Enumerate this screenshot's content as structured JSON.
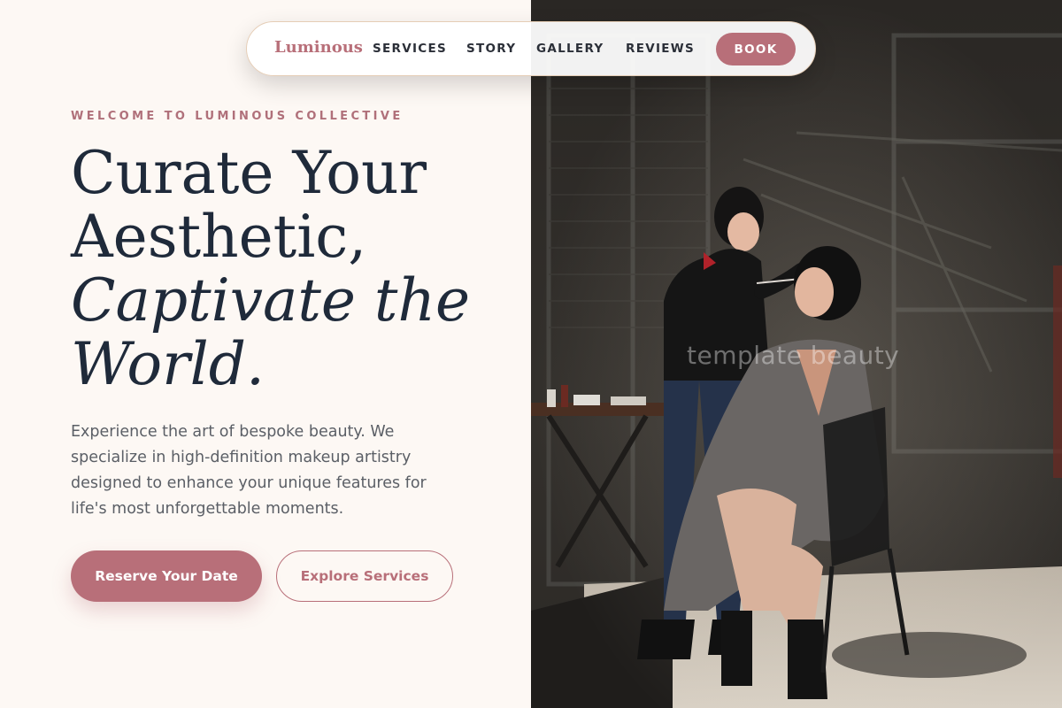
{
  "nav": {
    "brand": "Luminous",
    "links": [
      "SERVICES",
      "STORY",
      "GALLERY",
      "REVIEWS"
    ],
    "cta": "BOOK"
  },
  "hero": {
    "eyebrow": "WELCOME TO LUMINOUS COLLECTIVE",
    "headline": {
      "line1": "Curate Your",
      "line2": "Aesthetic,",
      "line3": "Captivate the",
      "line4": "World."
    },
    "body": "Experience the art of bespoke beauty. We specialize in high-definition makeup artistry designed to enhance your unique features for life's most unforgettable moments.",
    "primary_cta": "Reserve Your Date",
    "secondary_cta": "Explore Services"
  },
  "photo": {
    "watermark": "template beauty"
  },
  "colors": {
    "accent": "#b86f79",
    "heading": "#1f2a3a",
    "background": "#fdf8f4"
  }
}
